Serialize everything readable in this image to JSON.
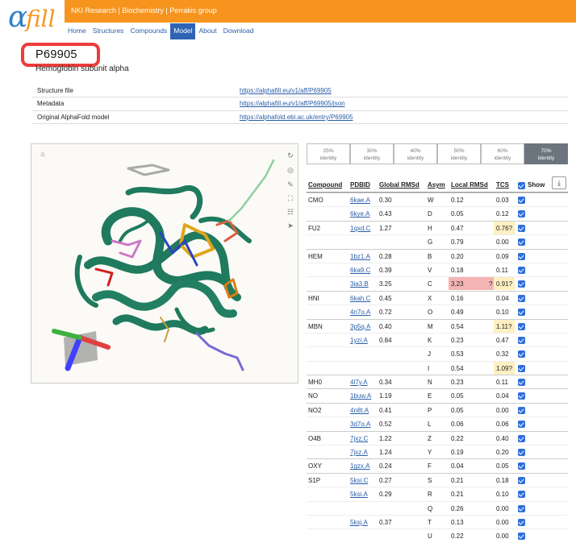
{
  "logo": {
    "alpha": "α",
    "fill": "fill"
  },
  "header": {
    "title": "NKI Research | Biochemistry | Perrakis group"
  },
  "nav": [
    "Home",
    "Structures",
    "Compounds",
    "Model",
    "About",
    "Download"
  ],
  "nav_active": "Model",
  "protein": {
    "id": "P69905",
    "name": "Hemoglobin subunit alpha"
  },
  "info": [
    {
      "label": "Structure file",
      "value": "https://alphafill.eu/v1/aff/P69905"
    },
    {
      "label": "Metadata",
      "value": "https://alphafill.eu/v1/aff/P69905/json"
    },
    {
      "label": "Original AlphaFold model",
      "value": "https://alphafold.ebi.ac.uk/entry/P69905"
    }
  ],
  "identity_tabs": [
    {
      "pct": "25%",
      "label": "identity"
    },
    {
      "pct": "30%",
      "label": "identity"
    },
    {
      "pct": "40%",
      "label": "identity"
    },
    {
      "pct": "50%",
      "label": "identity"
    },
    {
      "pct": "60%",
      "label": "identity"
    },
    {
      "pct": "70%",
      "label": "identity",
      "active": true
    }
  ],
  "table": {
    "headers": {
      "compound": "Compound",
      "pdbid": "PDBID",
      "global": "Global RMSd",
      "asym": "Asym",
      "local": "Local RMSd",
      "tcs": "TCS",
      "show": "Show"
    },
    "rows": [
      {
        "compound": "CMO",
        "pdbid": "6kae.A",
        "global": "0.30",
        "asym": "W",
        "local": "0.12",
        "tcs": "0.03"
      },
      {
        "compound": "",
        "pdbid": "6kye.A",
        "global": "0.43",
        "asym": "D",
        "local": "0.05",
        "tcs": "0.12"
      },
      {
        "compound": "FU2",
        "pdbid": "1qxd.C",
        "global": "1.27",
        "asym": "H",
        "local": "0.47",
        "tcs": "0.76?",
        "tcs_flag": "warn"
      },
      {
        "compound": "",
        "pdbid": "",
        "global": "",
        "asym": "G",
        "local": "0.79",
        "tcs": "0.00"
      },
      {
        "compound": "HEM",
        "pdbid": "1bz1.A",
        "global": "0.28",
        "asym": "B",
        "local": "0.20",
        "tcs": "0.09"
      },
      {
        "compound": "",
        "pdbid": "6ka9.C",
        "global": "0.39",
        "asym": "V",
        "local": "0.18",
        "tcs": "0.11"
      },
      {
        "compound": "",
        "pdbid": "3ia3.B",
        "global": "3.25",
        "asym": "C",
        "local": "3.23",
        "local_flag": "bad",
        "local_q": "?",
        "tcs": "0.91?",
        "tcs_flag": "warn"
      },
      {
        "compound": "HNI",
        "pdbid": "6kah.C",
        "global": "0.45",
        "asym": "X",
        "local": "0.16",
        "tcs": "0.04"
      },
      {
        "compound": "",
        "pdbid": "4n7o.A",
        "global": "0.72",
        "asym": "O",
        "local": "0.49",
        "tcs": "0.10"
      },
      {
        "compound": "MBN",
        "pdbid": "3p5q.A",
        "global": "0.40",
        "asym": "M",
        "local": "0.54",
        "tcs": "1.11?",
        "tcs_flag": "warn"
      },
      {
        "compound": "",
        "pdbid": "1yzi.A",
        "global": "0.84",
        "asym": "K",
        "local": "0.23",
        "tcs": "0.47"
      },
      {
        "compound": "",
        "pdbid": "",
        "global": "",
        "asym": "J",
        "local": "0.53",
        "tcs": "0.32"
      },
      {
        "compound": "",
        "pdbid": "",
        "global": "",
        "asym": "I",
        "local": "0.54",
        "tcs": "1.09?",
        "tcs_flag": "warn"
      },
      {
        "compound": "MH0",
        "pdbid": "4l7y.A",
        "global": "0.34",
        "asym": "N",
        "local": "0.23",
        "tcs": "0.11"
      },
      {
        "compound": "NO",
        "pdbid": "1buw.A",
        "global": "1.19",
        "asym": "E",
        "local": "0.05",
        "tcs": "0.04"
      },
      {
        "compound": "NO2",
        "pdbid": "4n8t.A",
        "global": "0.41",
        "asym": "P",
        "local": "0.05",
        "tcs": "0.00"
      },
      {
        "compound": "",
        "pdbid": "3d7o.A",
        "global": "0.52",
        "asym": "L",
        "local": "0.06",
        "tcs": "0.06"
      },
      {
        "compound": "O4B",
        "pdbid": "7jxz.C",
        "global": "1.22",
        "asym": "Z",
        "local": "0.22",
        "tcs": "0.40"
      },
      {
        "compound": "",
        "pdbid": "7jxz.A",
        "global": "1.24",
        "asym": "Y",
        "local": "0.19",
        "tcs": "0.20"
      },
      {
        "compound": "OXY",
        "pdbid": "1gzx.A",
        "global": "0.24",
        "asym": "F",
        "local": "0.04",
        "tcs": "0.05"
      },
      {
        "compound": "S1P",
        "pdbid": "5ksi.C",
        "global": "0.27",
        "asym": "S",
        "local": "0.21",
        "tcs": "0.18"
      },
      {
        "compound": "",
        "pdbid": "5ksi.A",
        "global": "0.29",
        "asym": "R",
        "local": "0.21",
        "tcs": "0.10"
      },
      {
        "compound": "",
        "pdbid": "",
        "global": "",
        "asym": "Q",
        "local": "0.26",
        "tcs": "0.00"
      },
      {
        "compound": "",
        "pdbid": "5ksj.A",
        "global": "0.37",
        "asym": "T",
        "local": "0.13",
        "tcs": "0.00"
      },
      {
        "compound": "",
        "pdbid": "",
        "global": "",
        "asym": "U",
        "local": "0.22",
        "tcs": "0.00"
      }
    ]
  },
  "colors": {
    "orange": "#f7941d",
    "blue": "#2f64b4",
    "warn": "#fff0c2",
    "bad": "#f5b4b4",
    "protein": "#1f7a5e"
  },
  "viewer_icons": [
    "molecule-icon",
    "refresh-icon",
    "target-icon",
    "wrench-icon",
    "expand-icon",
    "sliders-icon",
    "cursor-icon"
  ]
}
